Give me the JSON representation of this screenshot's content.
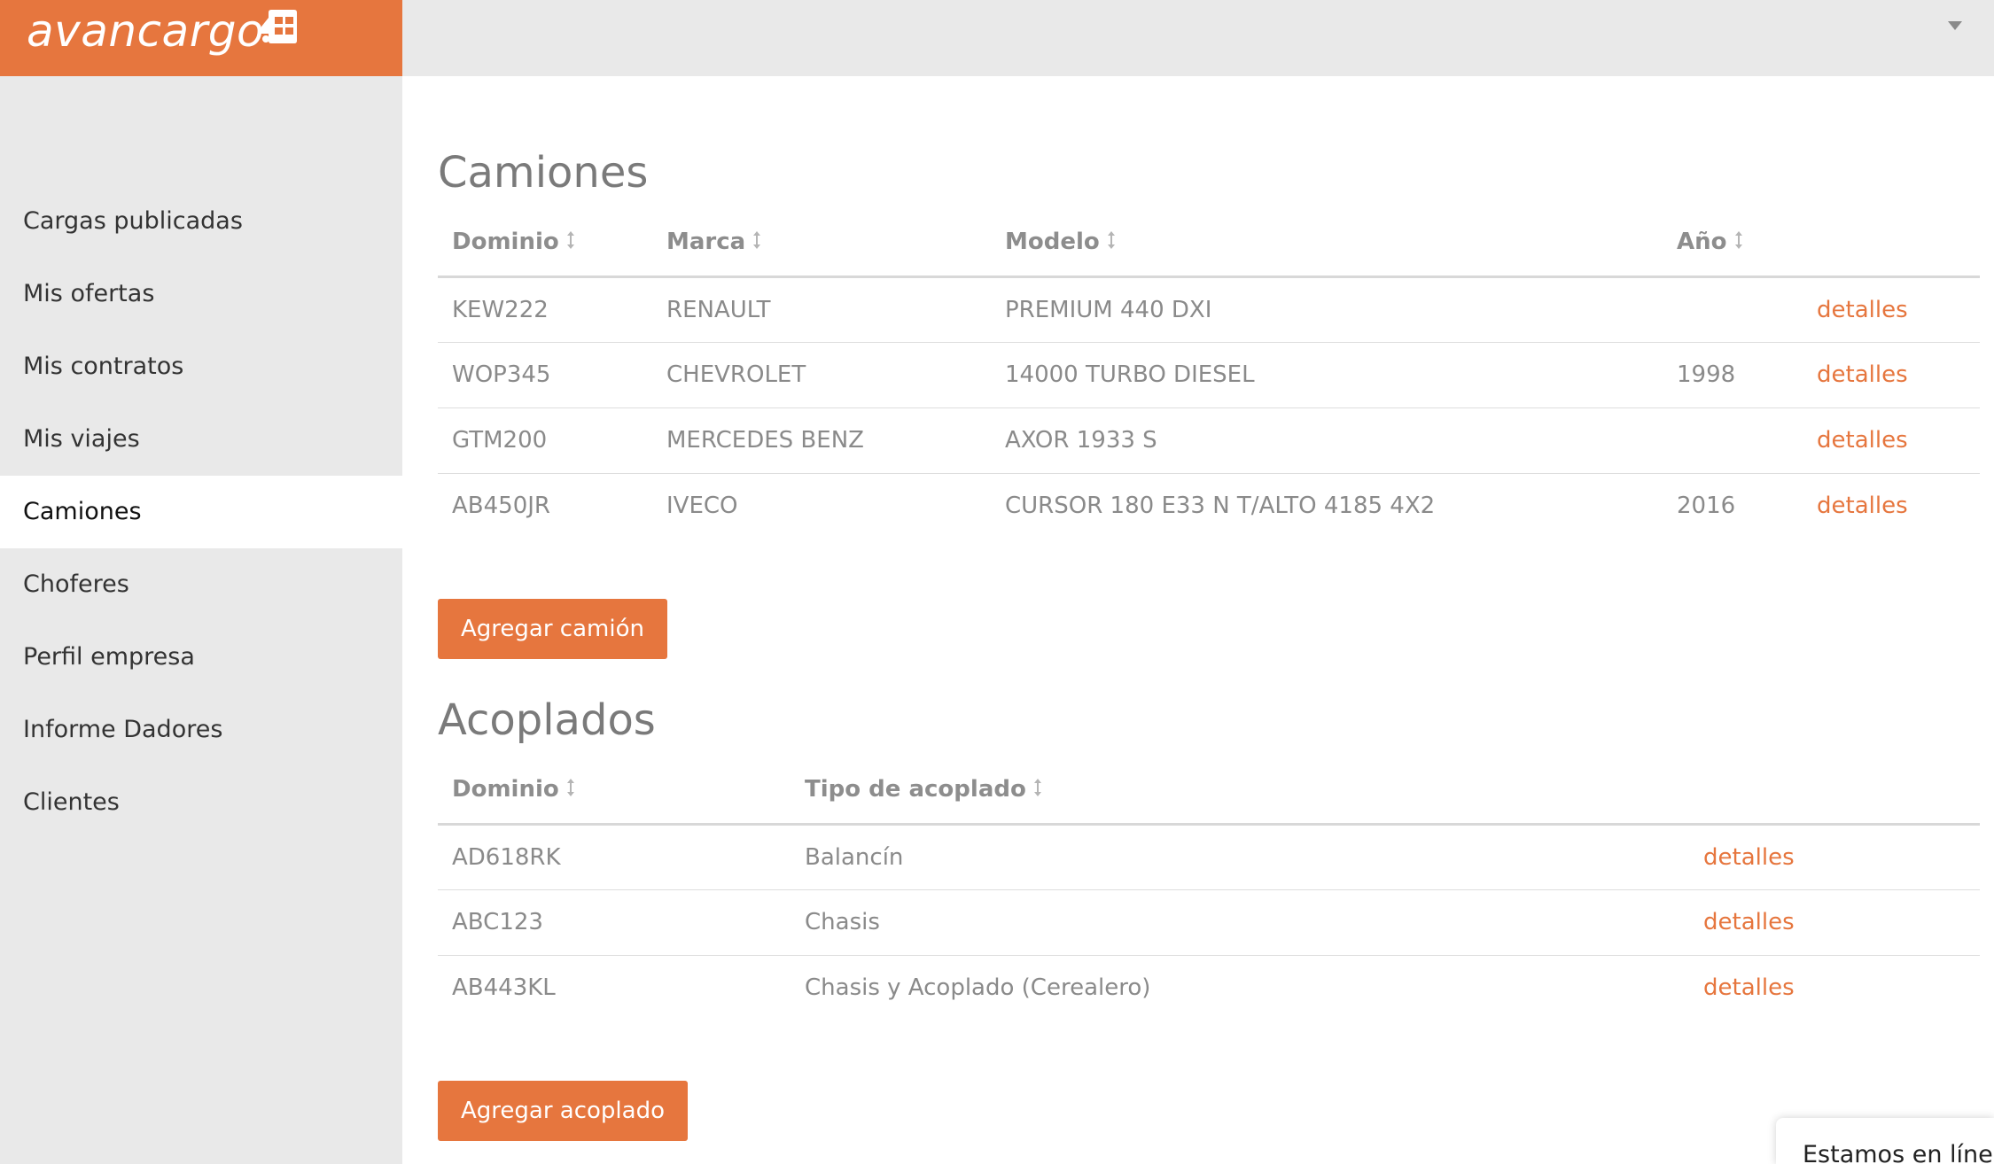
{
  "brand": {
    "name": "avancargo",
    "color": "#e6763e"
  },
  "sidebar": {
    "items": [
      {
        "label": "Cargas publicadas"
      },
      {
        "label": "Mis ofertas"
      },
      {
        "label": "Mis contratos"
      },
      {
        "label": "Mis viajes"
      },
      {
        "label": "Camiones",
        "active": true
      },
      {
        "label": "Choferes"
      },
      {
        "label": "Perfil empresa"
      },
      {
        "label": "Informe Dadores"
      },
      {
        "label": "Clientes"
      }
    ]
  },
  "trucks": {
    "title": "Camiones",
    "columns": [
      "Dominio",
      "Marca",
      "Modelo",
      "Año"
    ],
    "rows": [
      {
        "dominio": "KEW222",
        "marca": "RENAULT",
        "modelo": "PREMIUM 440 DXI",
        "anio": "",
        "link": "detalles"
      },
      {
        "dominio": "WOP345",
        "marca": "CHEVROLET",
        "modelo": "14000 TURBO DIESEL",
        "anio": "1998",
        "link": "detalles"
      },
      {
        "dominio": "GTM200",
        "marca": "MERCEDES BENZ",
        "modelo": "AXOR 1933 S",
        "anio": "",
        "link": "detalles"
      },
      {
        "dominio": "AB450JR",
        "marca": "IVECO",
        "modelo": "CURSOR 180 E33 N T/ALTO 4185 4X2",
        "anio": "2016",
        "link": "detalles"
      }
    ],
    "add_button": "Agregar camión"
  },
  "trailers": {
    "title": "Acoplados",
    "columns": [
      "Dominio",
      "Tipo de acoplado"
    ],
    "rows": [
      {
        "dominio": "AD618RK",
        "tipo": "Balancín",
        "link": "detalles"
      },
      {
        "dominio": "ABC123",
        "tipo": "Chasis",
        "link": "detalles"
      },
      {
        "dominio": "AB443KL",
        "tipo": "Chasis y Acoplado (Cerealero)",
        "link": "detalles"
      }
    ],
    "add_button": "Agregar acoplado"
  },
  "chat": {
    "label": "Estamos en línea"
  }
}
